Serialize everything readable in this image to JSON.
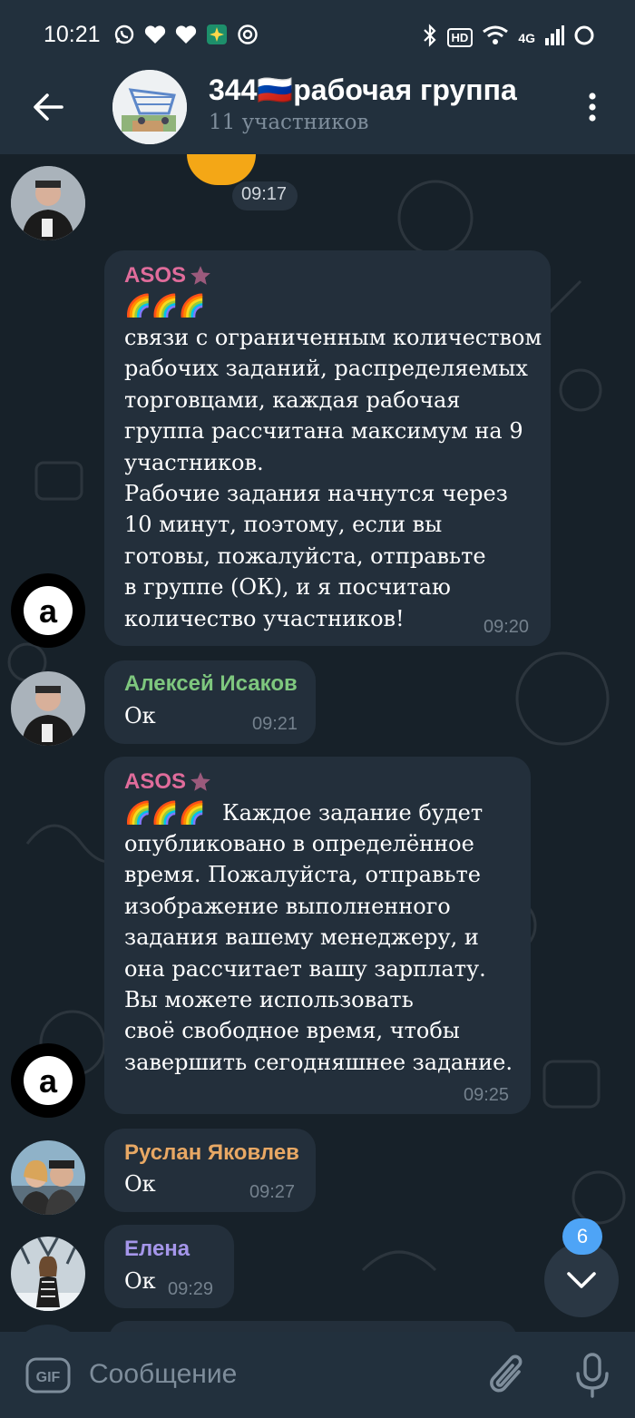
{
  "status_bar": {
    "time": "10:21",
    "hd_label": "HD",
    "network": "4G"
  },
  "header": {
    "title": "344🇷🇺рабочая группа",
    "subtitle": "11 участников"
  },
  "messages": [
    {
      "type": "time_only",
      "time": "09:17"
    },
    {
      "sender": "ASOS",
      "sender_color": "#e06c9b",
      "emoji": "🌈🌈🌈",
      "text": "связи с ограниченным количеством\nрабочих заданий, распределяемых\nторговцами, каждая рабочая\nгруппа рассчитана максимум на 9\nучастников.\nРабочие задания начнутся через\n10 минут, поэтому, если вы\nготовы, пожалуйста, отправьте\nв группе (ОК), и я посчитаю\nколичество участников!",
      "time": "09:20"
    },
    {
      "sender": "Алексей Исаков",
      "sender_color": "#7ec77e",
      "text": "Ок",
      "time": "09:21"
    },
    {
      "sender": "ASOS",
      "sender_color": "#e06c9b",
      "emoji": "🌈🌈🌈",
      "first_line": "Каждое задание будет",
      "text": "опубликовано в определённое\nвремя. Пожалуйста, отправьте\nизображение выполненного\nзадания вашему менеджеру, и\nона рассчитает вашу зарплату.\nВы можете использовать\nсвоё свободное время, чтобы\nзавершить сегодняшнее задание.",
      "time": "09:25"
    },
    {
      "sender": "Руслан Яковлев",
      "sender_color": "#e8a864",
      "text": "Ок",
      "time": "09:27"
    },
    {
      "sender": "Елена",
      "sender_color": "#a596ea",
      "text": "Ок",
      "time": "09:29"
    }
  ],
  "scroll_button": {
    "unread_count": "6"
  },
  "input": {
    "placeholder": "Сообщение",
    "gif_label": "GIF"
  },
  "icons": [
    "back-arrow-icon",
    "more-vertical-icon",
    "chevron-down-icon",
    "gif-icon",
    "paperclip-icon",
    "microphone-icon",
    "star-icon"
  ]
}
